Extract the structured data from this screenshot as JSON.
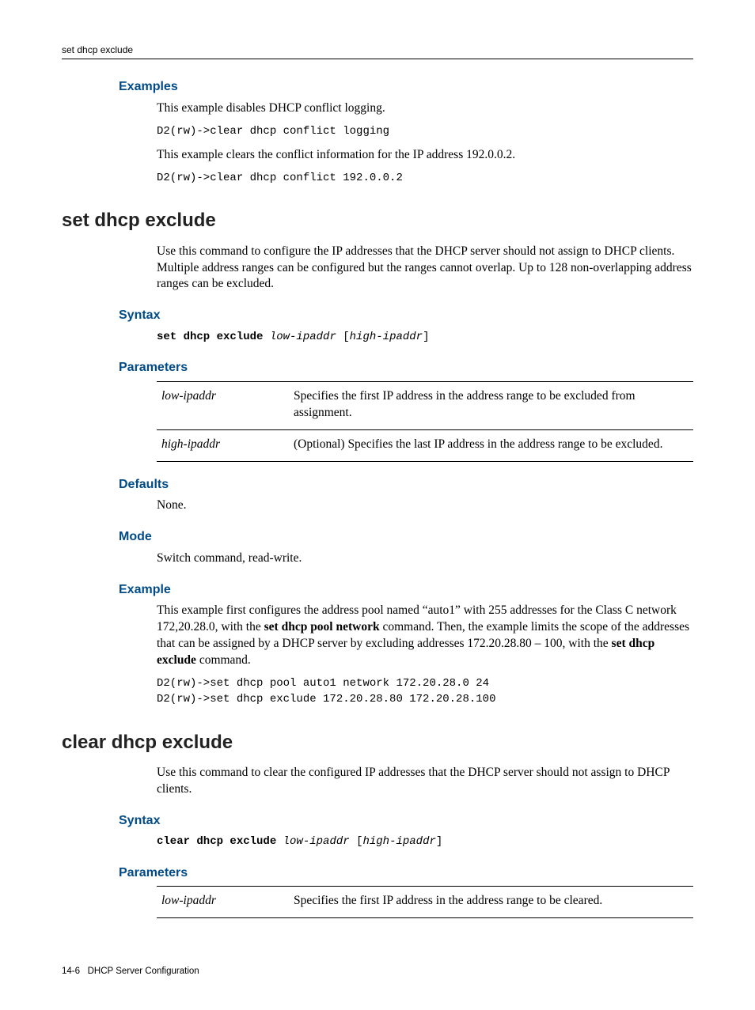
{
  "header": {
    "running": "set dhcp exclude"
  },
  "sec1": {
    "h_examples": "Examples",
    "p1": "This example disables DHCP conflict logging.",
    "c1": "D2(rw)->clear dhcp conflict logging",
    "p2": "This example clears the conflict information for the IP address 192.0.0.2.",
    "c2": "D2(rw)->clear dhcp conflict 192.0.0.2"
  },
  "sec2": {
    "title": "set dhcp exclude",
    "intro": "Use this command to configure the IP addresses that the DHCP server should not assign to DHCP clients. Multiple address ranges can be configured but the ranges cannot overlap. Up to 128 non-overlapping address ranges can be excluded.",
    "h_syntax": "Syntax",
    "syntax_cmd": "set dhcp exclude",
    "syntax_arg1": "low-ipaddr",
    "syntax_lb": "[",
    "syntax_arg2": "high-ipaddr",
    "syntax_rb": "]",
    "h_params": "Parameters",
    "params": [
      {
        "name": "low-ipaddr",
        "desc": "Specifies the first IP address in the address range to be excluded from assignment."
      },
      {
        "name": "high-ipaddr",
        "desc": "(Optional) Specifies the last IP address in the address range to be excluded."
      }
    ],
    "h_defaults": "Defaults",
    "defaults_body": "None.",
    "h_mode": "Mode",
    "mode_body": "Switch command, read-write.",
    "h_example": "Example",
    "ex_pre": "This example first configures the address pool named “auto1” with 255 addresses for the Class C network 172,20.28.0, with the ",
    "ex_bold1": "set dhcp pool network",
    "ex_mid": " command. Then, the example limits the scope of the addresses that can be assigned by a DHCP server by excluding addresses 172.20.28.80 – 100, with the ",
    "ex_bold2": "set dhcp exclude",
    "ex_post": " command.",
    "ex_code": "D2(rw)->set dhcp pool auto1 network 172.20.28.0 24\nD2(rw)->set dhcp exclude 172.20.28.80 172.20.28.100"
  },
  "sec3": {
    "title": "clear dhcp exclude",
    "intro": "Use this command to clear the configured IP addresses that the DHCP server should not assign to DHCP clients.",
    "h_syntax": "Syntax",
    "syntax_cmd": "clear dhcp exclude",
    "syntax_arg1": "low-ipaddr",
    "syntax_lb": "[",
    "syntax_arg2": "high-ipaddr",
    "syntax_rb": "]",
    "h_params": "Parameters",
    "params": [
      {
        "name": "low-ipaddr",
        "desc": "Specifies the first IP address in the address range to be cleared."
      }
    ]
  },
  "footer": {
    "page": "14-6",
    "title": "DHCP Server Configuration"
  }
}
